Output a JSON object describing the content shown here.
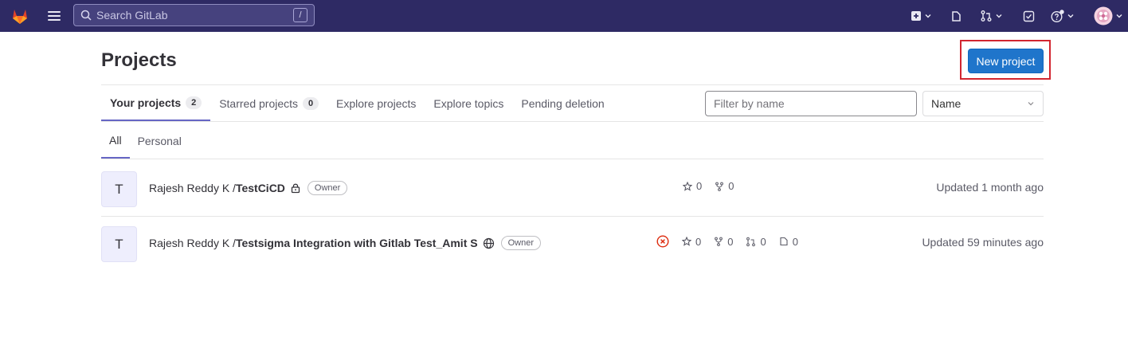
{
  "search": {
    "placeholder": "Search GitLab",
    "shortcut": "/"
  },
  "page": {
    "title": "Projects",
    "new_project_label": "New project"
  },
  "tabs": [
    {
      "label": "Your projects",
      "count": "2",
      "active": true
    },
    {
      "label": "Starred projects",
      "count": "0",
      "active": false
    },
    {
      "label": "Explore projects",
      "active": false
    },
    {
      "label": "Explore topics",
      "active": false
    },
    {
      "label": "Pending deletion",
      "active": false
    }
  ],
  "filter": {
    "placeholder": "Filter by name"
  },
  "sort": {
    "selected": "Name"
  },
  "subtabs": [
    {
      "label": "All",
      "active": true
    },
    {
      "label": "Personal",
      "active": false
    }
  ],
  "projects": [
    {
      "avatar": "T",
      "namespace": "Rajesh Reddy K / ",
      "name": "TestCiCD",
      "visibility_icon": "lock-icon",
      "role": "Owner",
      "stars": "0",
      "forks": "0",
      "updated": "Updated 1 month ago"
    },
    {
      "avatar": "T",
      "namespace": "Rajesh Reddy K / ",
      "name": "Testsigma Integration with Gitlab Test_Amit S",
      "visibility_icon": "globe-icon",
      "role": "Owner",
      "pipeline_status": "failed",
      "stars": "0",
      "forks": "0",
      "merge_requests": "0",
      "issues": "0",
      "updated": "Updated 59 minutes ago"
    }
  ],
  "colors": {
    "topbar": "#2e2a64",
    "primary_button": "#1f75cb",
    "highlight_box": "#d22630",
    "active_tab_border": "#6666c4",
    "failed_status": "#dd2b0e"
  }
}
